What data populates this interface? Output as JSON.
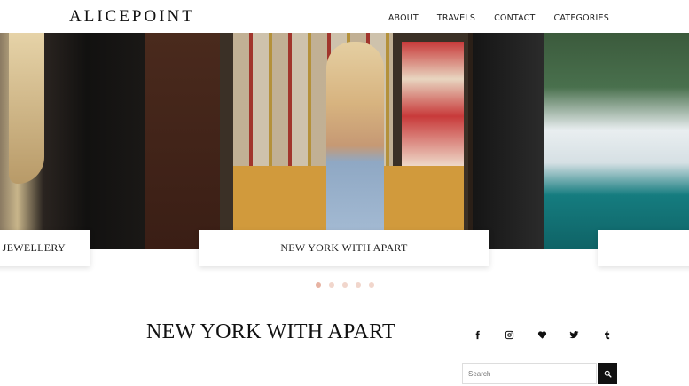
{
  "site": {
    "logo": "ALICEPOINT"
  },
  "nav": {
    "items": [
      "ABOUT",
      "TRAVELS",
      "CONTACT",
      "CATEGORIES"
    ]
  },
  "slider": {
    "captions": [
      "RT JEWELLERY",
      "NEW YORK WITH APART",
      ""
    ],
    "dots": 5,
    "active_dot": 1
  },
  "post": {
    "title": "NEW YORK WITH APART"
  },
  "social": {
    "icons": [
      "facebook-icon",
      "instagram-icon",
      "heart-icon",
      "twitter-icon",
      "tumblr-icon"
    ]
  },
  "search": {
    "placeholder": "Search"
  },
  "colors": {
    "dot_active": "#e7b3a3",
    "dot_inactive": "#f1d6cc",
    "search_button": "#111111"
  }
}
